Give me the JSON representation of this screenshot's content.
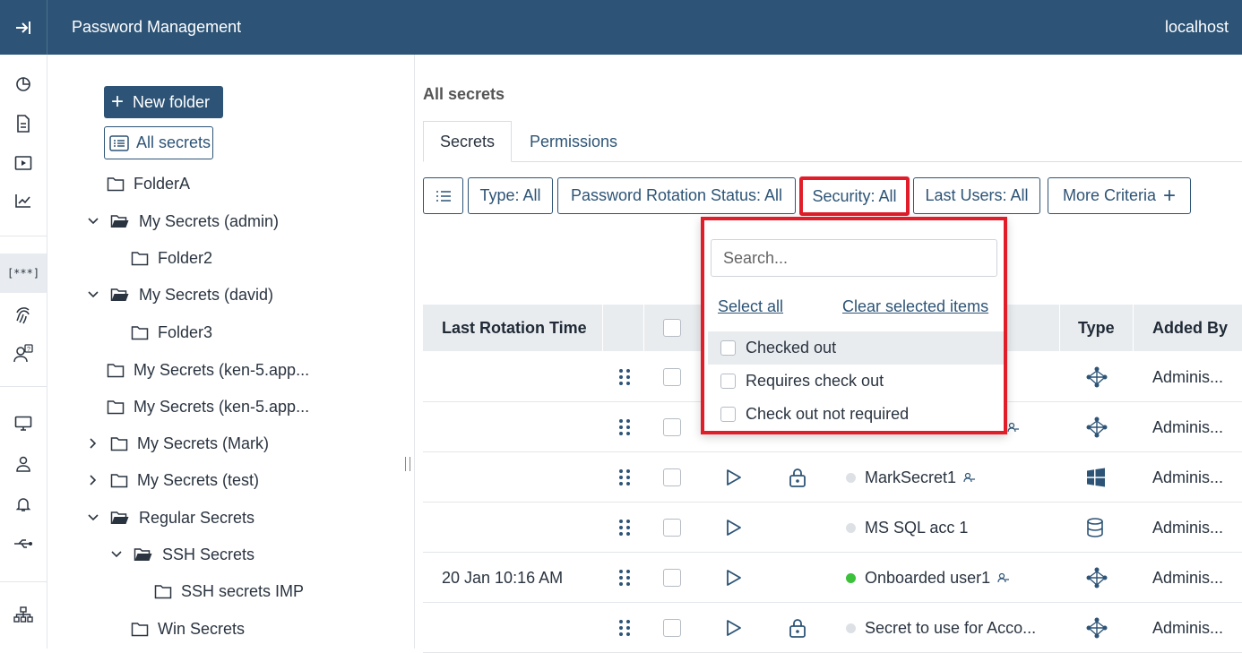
{
  "header": {
    "title": "Password Management",
    "host": "localhost"
  },
  "rail": {
    "icons": [
      "dashboard-icon",
      "document-icon",
      "play-icon",
      "chart-icon",
      "secrets-icon",
      "fingerprint-icon",
      "user-question-icon",
      "monitor-icon",
      "user-icon",
      "bell-icon",
      "usb-icon",
      "sitemap-icon"
    ],
    "active_icon": "[***]"
  },
  "tree": {
    "new_folder": "New folder",
    "all_secrets": "All secrets",
    "items": [
      {
        "label": "FolderA"
      },
      {
        "label": "My Secrets (admin)"
      },
      {
        "label": "Folder2"
      },
      {
        "label": "My Secrets (david)"
      },
      {
        "label": "Folder3"
      },
      {
        "label": "My Secrets (ken-5.app..."
      },
      {
        "label": "My Secrets (ken-5.app..."
      },
      {
        "label": "My Secrets (Mark)"
      },
      {
        "label": "My Secrets (test)"
      },
      {
        "label": "Regular Secrets"
      },
      {
        "label": "SSH Secrets"
      },
      {
        "label": "SSH secrets IMP"
      },
      {
        "label": "Win Secrets"
      }
    ]
  },
  "main": {
    "breadcrumb": "All secrets",
    "tabs": [
      "Secrets",
      "Permissions"
    ],
    "filters": {
      "type": "Type: All",
      "rotation": "Password Rotation Status: All",
      "security": "Security: All",
      "last_users": "Last Users: All",
      "more": "More Criteria"
    },
    "columns": {
      "last_rotation": "Last Rotation Time",
      "type": "Type",
      "added_by": "Added By"
    },
    "rows": [
      {
        "rotation": "",
        "name": "",
        "added_by": "Adminis..."
      },
      {
        "rotation": "",
        "name": "",
        "added_by": "Adminis..."
      },
      {
        "rotation": "",
        "name": "MarkSecret1",
        "added_by": "Adminis..."
      },
      {
        "rotation": "",
        "name": "MS SQL acc 1",
        "added_by": "Adminis..."
      },
      {
        "rotation": "20 Jan 10:16 AM",
        "name": "Onboarded user1",
        "added_by": "Adminis..."
      },
      {
        "rotation": "",
        "name": "Secret to use for Acco...",
        "added_by": "Adminis..."
      }
    ]
  },
  "dropdown": {
    "search_placeholder": "Search...",
    "select_all": "Select all",
    "clear": "Clear selected items",
    "options": [
      "Checked out",
      "Requires check out",
      "Check out not required"
    ]
  },
  "colors": {
    "primary": "#2d5476",
    "highlight": "#e11d2a",
    "status_green": "#3cc13b",
    "status_grey": "#dde1e5"
  }
}
